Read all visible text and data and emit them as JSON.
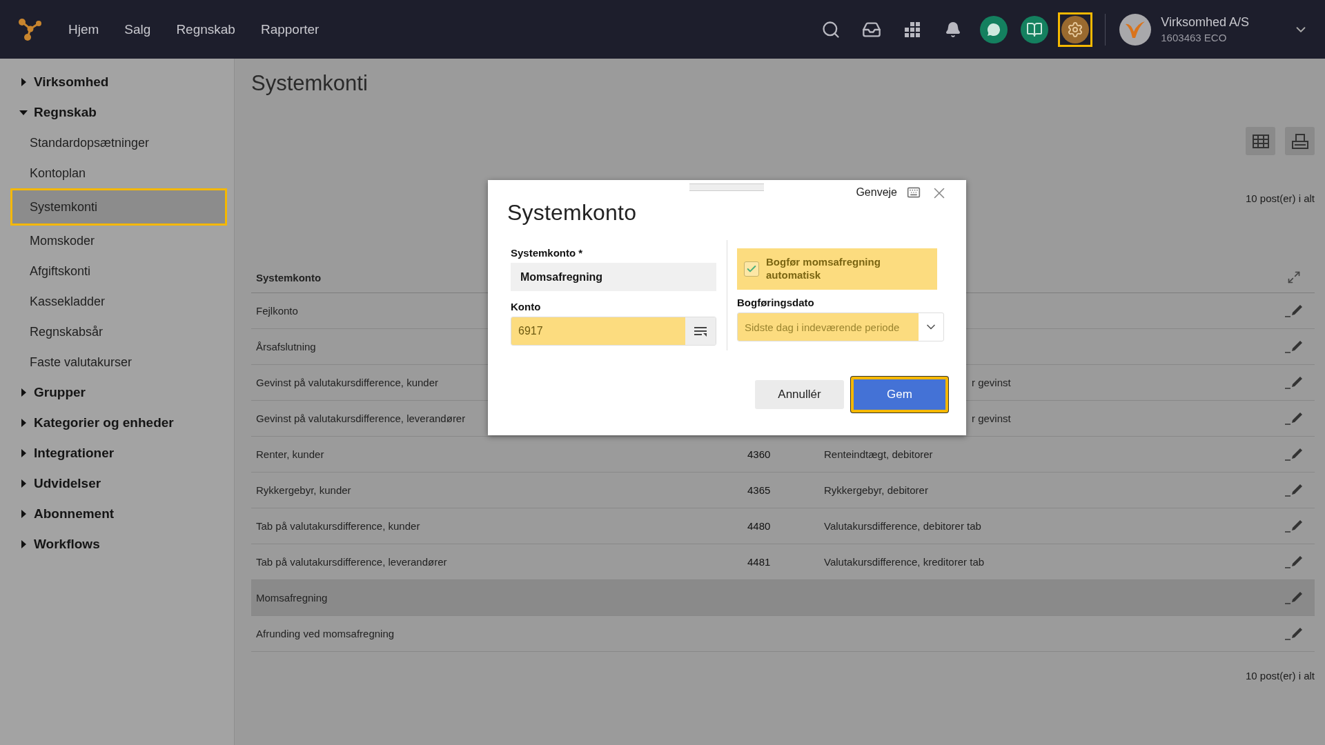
{
  "topbar": {
    "nav": [
      {
        "label": "Hjem"
      },
      {
        "label": "Salg"
      },
      {
        "label": "Regnskab"
      },
      {
        "label": "Rapporter"
      }
    ],
    "icons": [
      {
        "kind": "search",
        "highlighted": false
      },
      {
        "kind": "inbox",
        "highlighted": false
      },
      {
        "kind": "apps",
        "highlighted": false
      },
      {
        "kind": "notifications",
        "highlighted": false
      },
      {
        "kind": "chat",
        "highlighted": false
      },
      {
        "kind": "guide",
        "highlighted": false
      },
      {
        "kind": "settings",
        "highlighted": true
      }
    ],
    "company": {
      "name": "Virksomhed A/S",
      "id": "1603463 ECO"
    }
  },
  "sidebar": {
    "items": [
      {
        "label": "Virksomhed",
        "expanded": false
      },
      {
        "label": "Regnskab",
        "expanded": true,
        "children": [
          {
            "label": "Standardopsætninger",
            "selected": false
          },
          {
            "label": "Kontoplan",
            "selected": false
          },
          {
            "label": "Systemkonti",
            "selected": true
          },
          {
            "label": "Momskoder",
            "selected": false
          },
          {
            "label": "Afgiftskonti",
            "selected": false
          },
          {
            "label": "Kassekladder",
            "selected": false
          },
          {
            "label": "Regnskabsår",
            "selected": false
          },
          {
            "label": "Faste valutakurser",
            "selected": false
          }
        ]
      },
      {
        "label": "Grupper",
        "expanded": false
      },
      {
        "label": "Kategorier og enheder",
        "expanded": false
      },
      {
        "label": "Integrationer",
        "expanded": false
      },
      {
        "label": "Udvidelser",
        "expanded": false
      },
      {
        "label": "Abonnement",
        "expanded": false
      },
      {
        "label": "Workflows",
        "expanded": false
      }
    ]
  },
  "page": {
    "title": "Systemkonti",
    "count_top": "10 post(er) i alt",
    "count_bottom": "10 post(er) i alt",
    "table": {
      "columns": [
        "Systemkonto"
      ],
      "rows": [
        {
          "name": "Fejlkonto",
          "selected": false
        },
        {
          "name": "Årsafslutning",
          "selected": false
        },
        {
          "name": "Gevinst på valutakursdifference, kunder",
          "description": "r gevinst",
          "cut": true,
          "selected": false
        },
        {
          "name": "Gevinst på valutakursdifference, leverandører",
          "description": "r gevinst",
          "cut": true,
          "selected": false
        },
        {
          "name": "Renter, kunder",
          "number": "4360",
          "description": "Renteindtægt, debitorer",
          "selected": false
        },
        {
          "name": "Rykkergebyr, kunder",
          "number": "4365",
          "description": "Rykkergebyr, debitorer",
          "selected": false
        },
        {
          "name": "Tab på valutakursdifference, kunder",
          "number": "4480",
          "description": "Valutakursdifference, debitorer tab",
          "selected": false
        },
        {
          "name": "Tab på valutakursdifference, leverandører",
          "number": "4481",
          "description": "Valutakursdifference, kreditorer tab",
          "selected": false
        },
        {
          "name": "Momsafregning",
          "selected": true
        },
        {
          "name": "Afrunding ved momsafregning",
          "selected": false
        }
      ]
    }
  },
  "dialog": {
    "title": "Systemkonto",
    "shortcuts": "Genveje",
    "systemkonto": {
      "label": "Systemkonto *",
      "value": "Momsafregning"
    },
    "konto": {
      "label": "Konto",
      "value": "6917"
    },
    "auto_post": {
      "label": "Bogfør momsafregning automatisk",
      "checked": true
    },
    "posting_date": {
      "label": "Bogføringsdato",
      "value": "Sidste dag i indeværende periode"
    },
    "buttons": [
      {
        "label": "Annullér",
        "kind": "secondary",
        "highlighted": false
      },
      {
        "label": "Gem",
        "kind": "primary",
        "highlighted": true
      }
    ]
  }
}
